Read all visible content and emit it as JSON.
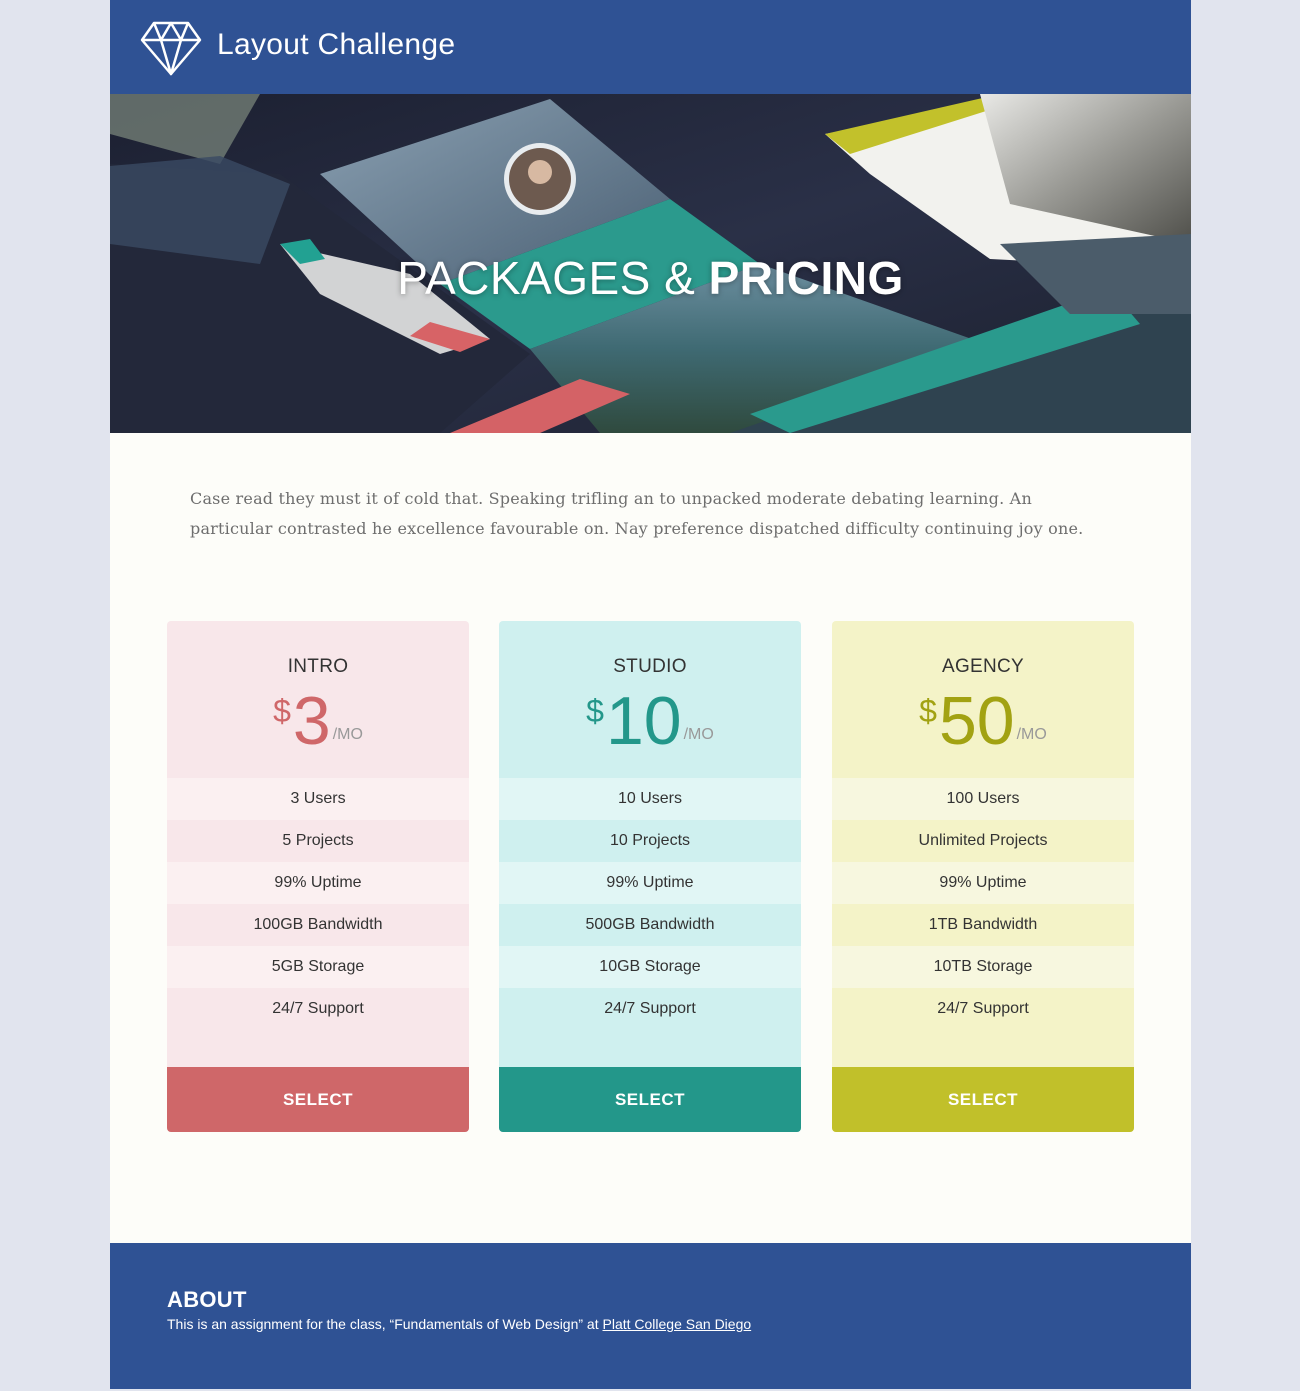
{
  "header": {
    "title": "Layout Challenge",
    "logo_icon": "diamond-icon"
  },
  "hero": {
    "title_light": "PACKAGES &",
    "title_bold": "PRICING"
  },
  "intro": {
    "text": "Case read they must it of cold that. Speaking trifling an to unpacked moderate debating learning. An particular contrasted he excellence favourable on. Nay preference dispatched difficulty continuing joy one."
  },
  "plans": [
    {
      "name": "INTRO",
      "currency": "$",
      "amount": "3",
      "period": "/MO",
      "features": [
        "3 Users",
        "5 Projects",
        "99% Uptime",
        "100GB Bandwidth",
        "5GB Storage",
        "24/7 Support"
      ],
      "button": "SELECT",
      "colors": {
        "bg": "#f8e7ea",
        "alt": "#fbf0f1",
        "accent": "#cf6769",
        "button": "#cf6769"
      }
    },
    {
      "name": "STUDIO",
      "currency": "$",
      "amount": "10",
      "period": "/MO",
      "features": [
        "10 Users",
        "10 Projects",
        "99% Uptime",
        "500GB Bandwidth",
        "10GB Storage",
        "24/7 Support"
      ],
      "button": "SELECT",
      "colors": {
        "bg": "#cff0ef",
        "alt": "#e1f6f5",
        "accent": "#23978a",
        "button": "#23978a"
      }
    },
    {
      "name": "AGENCY",
      "currency": "$",
      "amount": "50",
      "period": "/MO",
      "features": [
        "100 Users",
        "Unlimited Projects",
        "99% Uptime",
        "1TB Bandwidth",
        "10TB Storage",
        "24/7 Support"
      ],
      "button": "SELECT",
      "colors": {
        "bg": "#f4f3c8",
        "alt": "#f7f7df",
        "accent": "#a2a212",
        "button": "#c1c02a"
      }
    }
  ],
  "footer": {
    "heading": "ABOUT",
    "text": "This is an assignment for the class, “Fundamentals of Web Design” at ",
    "link": "Platt College San Diego"
  }
}
